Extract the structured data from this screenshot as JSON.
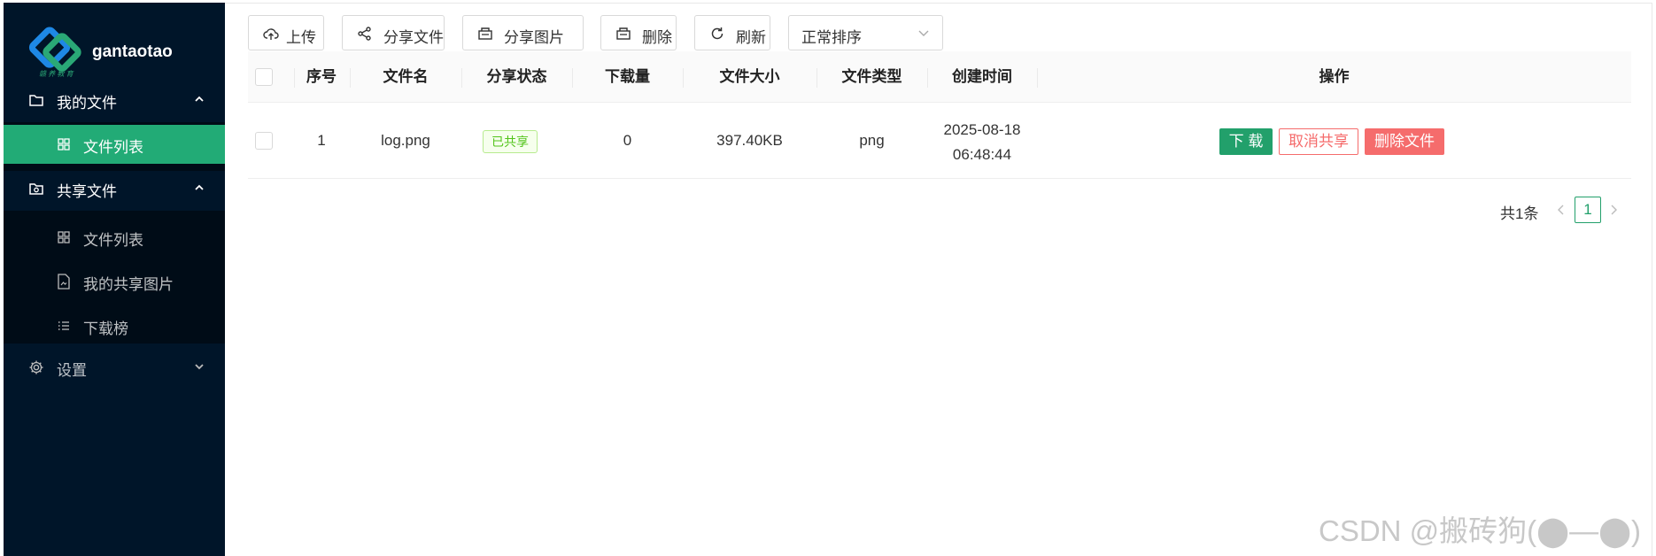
{
  "sidebar": {
    "logo": {
      "brand": "gantaotao",
      "sub": "赣 养 教 育"
    },
    "groups": [
      {
        "label": "我的文件",
        "icon": "folder-icon",
        "expanded": true,
        "items": [
          {
            "label": "文件列表",
            "icon": "grid-icon",
            "active": true
          }
        ]
      },
      {
        "label": "共享文件",
        "icon": "shared-folder-icon",
        "expanded": true,
        "items": [
          {
            "label": "文件列表",
            "icon": "grid-icon",
            "active": false
          },
          {
            "label": "我的共享图片",
            "icon": "file-image-icon",
            "active": false
          },
          {
            "label": "下载榜",
            "icon": "list-icon",
            "active": false
          }
        ]
      },
      {
        "label": "设置",
        "icon": "gear-icon",
        "expanded": false,
        "items": []
      }
    ]
  },
  "toolbar": {
    "buttons": [
      {
        "label": "上传",
        "icon": "cloud-upload-icon"
      },
      {
        "label": "分享文件",
        "icon": "share-icon"
      },
      {
        "label": "分享图片",
        "icon": "image-icon"
      },
      {
        "label": "删除",
        "icon": "trash-icon"
      },
      {
        "label": "刷新",
        "icon": "refresh-icon"
      }
    ],
    "sort": {
      "value": "正常排序"
    }
  },
  "table": {
    "columns": [
      "序号",
      "文件名",
      "分享状态",
      "下载量",
      "文件大小",
      "文件类型",
      "创建时间",
      "操作"
    ],
    "rows": [
      {
        "index": "1",
        "filename": "log.png",
        "share_status": "已共享",
        "downloads": "0",
        "size": "397.40KB",
        "type": "png",
        "created_date": "2025-08-18",
        "created_time": "06:48:44",
        "actions": {
          "download": "下 载",
          "unshare": "取消共享",
          "delete": "删除文件"
        }
      }
    ]
  },
  "pagination": {
    "total": "共1条",
    "current": "1"
  },
  "watermark": "CSDN @搬砖狗(⬤—⬤)",
  "colors": {
    "sidebar_bg": "#001529",
    "submenu_bg": "#000c17",
    "accent": "#22ab76",
    "danger": "#f56c6c"
  }
}
